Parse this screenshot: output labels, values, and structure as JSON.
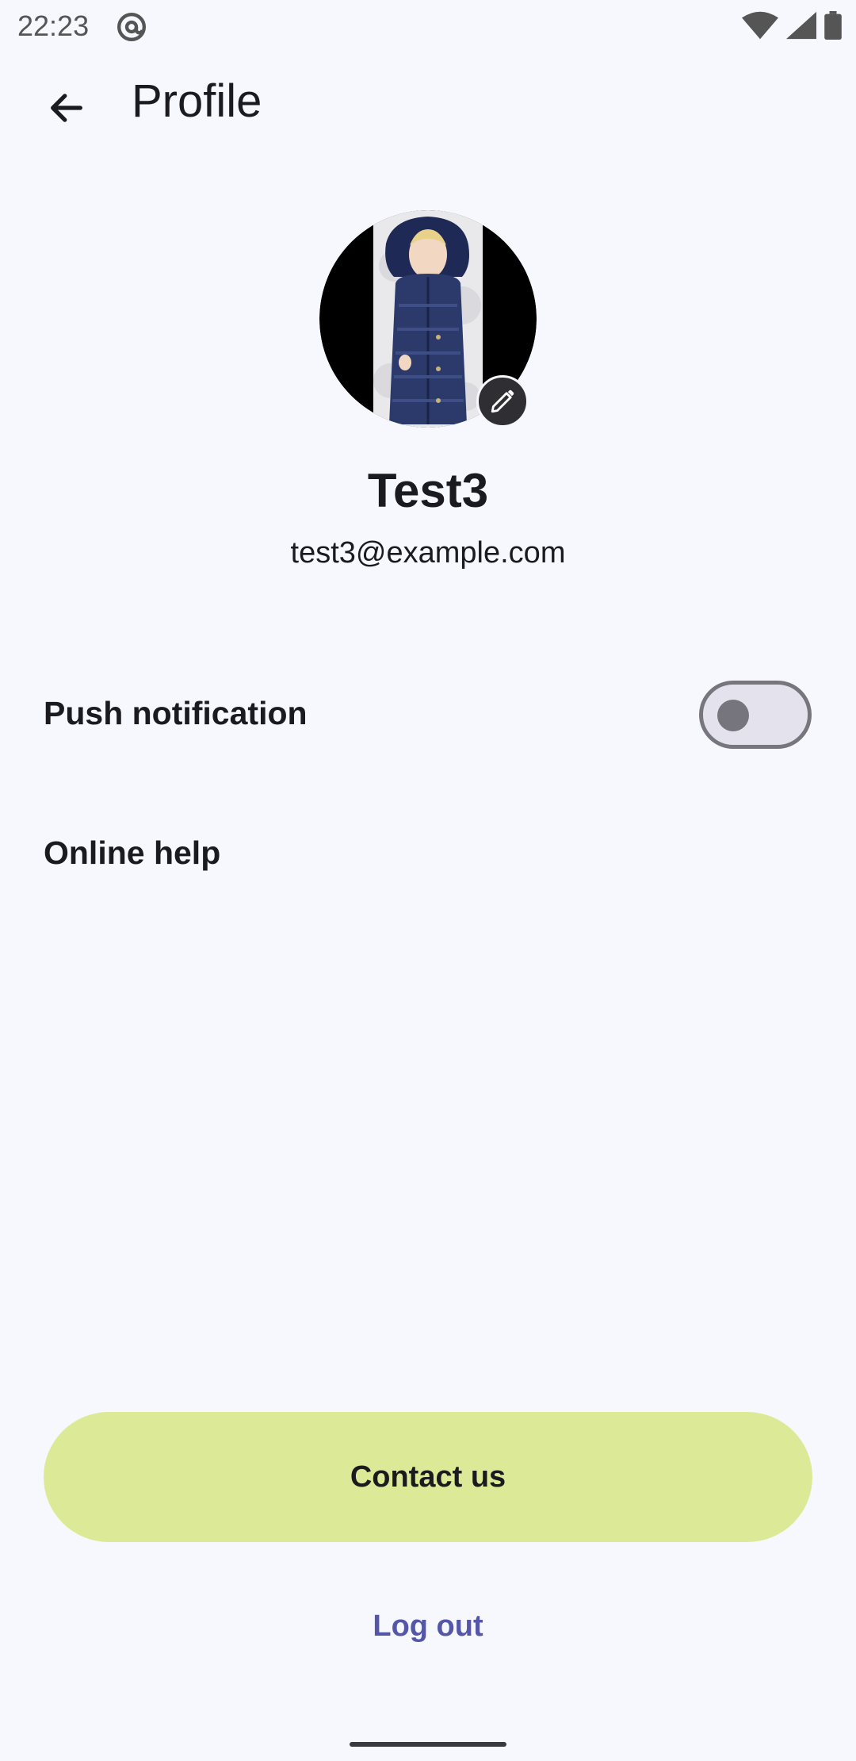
{
  "status_bar": {
    "time": "22:23",
    "icons": [
      "at-sign-icon",
      "wifi-icon",
      "cell-signal-icon",
      "battery-icon"
    ]
  },
  "app_bar": {
    "back_icon": "arrow-back-icon",
    "title": "Profile"
  },
  "profile": {
    "avatar_alt": "profile photo",
    "edit_icon": "pencil-icon",
    "name": "Test3",
    "email": "test3@example.com"
  },
  "settings": {
    "push_label": "Push notification",
    "push_enabled": false,
    "help_label": "Online help"
  },
  "actions": {
    "contact_label": "Contact us",
    "logout_label": "Log out"
  },
  "colors": {
    "background": "#F7F8FD",
    "contact_button": "#DCEA98",
    "logout_text": "#5457A8",
    "toggle_track": "#E4E2EC",
    "toggle_outline": "#77767D"
  }
}
